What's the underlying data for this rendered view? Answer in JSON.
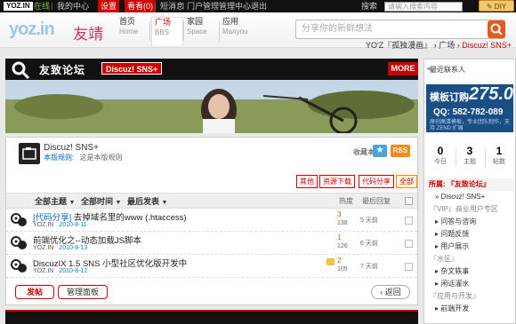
{
  "topbar": {
    "logo": "YOZ.IN",
    "links": [
      {
        "label": "在线",
        "style": "green"
      },
      {
        "label": "我的中心",
        "style": ""
      },
      {
        "label": "设置",
        "style": "red"
      },
      {
        "label": "看看(0)",
        "style": "red"
      },
      {
        "label": "短消息",
        "style": ""
      },
      {
        "label": "门户管理",
        "style": ""
      },
      {
        "label": "管理中心",
        "style": ""
      },
      {
        "label": "退出",
        "style": ""
      }
    ],
    "search_label": "搜索",
    "search_placeholder": "请输入搜索内容",
    "diy_label": "DIY"
  },
  "header": {
    "brand": "yoz.in",
    "brand_cn": "友靖",
    "nav": [
      {
        "cn": "首页",
        "en": "Home",
        "active": false
      },
      {
        "cn": "广场",
        "en": "BBS",
        "active": true
      },
      {
        "cn": "家园",
        "en": "Space",
        "active": false
      },
      {
        "cn": "应用",
        "en": "Manyou",
        "active": false
      }
    ],
    "search_placeholder": "分享你的新鲜想法"
  },
  "breadcrumb": {
    "site": "YO'Z『孤独漫画』",
    "forum": "广场",
    "page": "Discuz! SNS+"
  },
  "forum_header": {
    "title": "友致论坛",
    "badge": "Discuz! SNS+",
    "more": "MORE"
  },
  "forum_info": {
    "name": "Discuz! SNS+",
    "rules_label": "本版规则:",
    "rules_value": "这是本版规则",
    "fav_label": "收藏本版",
    "rss": "RSS"
  },
  "category_buttons": [
    {
      "label": "其他",
      "active": false
    },
    {
      "label": "资源下载",
      "active": false
    },
    {
      "label": "代码分享",
      "active": false
    },
    {
      "label": "全部",
      "active": true
    }
  ],
  "list_header": {
    "all_topics": "全部主题",
    "all_time": "全部时间",
    "latest": "最后发表",
    "hot_col": "热度",
    "last_col": "最后回复"
  },
  "threads": [
    {
      "tag": "[代码分享]",
      "title": "去掉域名里的www (.htaccess)",
      "author": "YOZ.IN",
      "date": "2010-8-11",
      "replies": "3",
      "views": "138",
      "last": "5 天前"
    },
    {
      "tag": "",
      "title": "前端优化之--动态加载JS脚本",
      "author": "YOZ.IN",
      "date": "2010-8-13",
      "replies": "1",
      "views": "126",
      "last": "6 天前"
    },
    {
      "tag": "",
      "title": "DiscuzIX 1.5 SNS 小型社区优化版开发中",
      "author": "YOZ.IN",
      "date": "2010-8-12",
      "replies": "2",
      "views": "105",
      "last": "7 天前"
    }
  ],
  "actions": {
    "post": "发帖",
    "manage": "管理面板",
    "back": "返回"
  },
  "sidebar": {
    "recent_contacts": "最近联系人",
    "promo": {
      "title": "模板订购",
      "price": "275.0",
      "qq": "QQ: 582-782-089",
      "note": "原创高清模板，专业团队制作，支持 ZEND 扩展"
    },
    "stats": [
      {
        "n": "0",
        "l": "今日"
      },
      {
        "n": "3",
        "l": "主题"
      },
      {
        "n": "1",
        "l": "帖数"
      }
    ],
    "forum_head_label": "所属:",
    "forum_head_value": "『友致论坛』",
    "items": [
      {
        "label": "Discuz! SNS+",
        "kind": "sub"
      },
      {
        "label": "『VIP』商业用户专区",
        "kind": "group"
      },
      {
        "label": "问答与咨询",
        "kind": "sub"
      },
      {
        "label": "问题反馈",
        "kind": "sub"
      },
      {
        "label": "用户展示",
        "kind": "sub"
      },
      {
        "label": "『水区』",
        "kind": "group"
      },
      {
        "label": "杂文轶事",
        "kind": "sub"
      },
      {
        "label": "闲话灌水",
        "kind": "sub"
      },
      {
        "label": "『应用与开发』",
        "kind": "group"
      },
      {
        "label": "前端开发",
        "kind": "sub"
      }
    ]
  },
  "colors": {
    "accent_red": "#cc0000",
    "top_black": "#111111",
    "promo_blue": "#1a4f86"
  }
}
